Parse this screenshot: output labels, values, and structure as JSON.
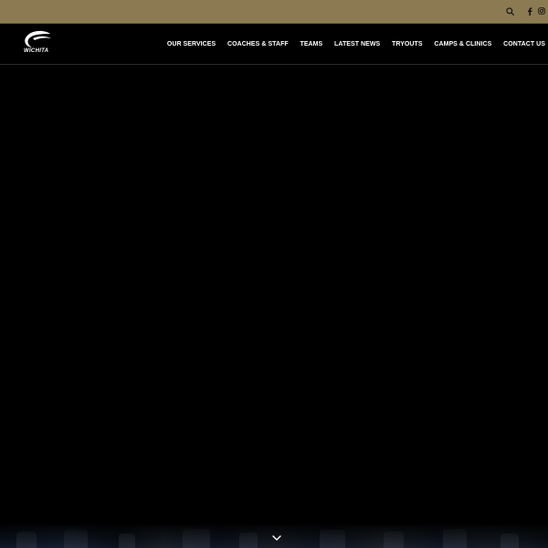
{
  "topbar": {
    "icons": [
      "search-icon",
      "facebook-icon",
      "instagram-icon"
    ],
    "background_color": "#8b7a52"
  },
  "header": {
    "logo_text": "WICHITA",
    "nav": [
      {
        "label": "OUR SERVICES"
      },
      {
        "label": "COACHES & STAFF"
      },
      {
        "label": "TEAMS"
      },
      {
        "label": "LATEST NEWS"
      },
      {
        "label": "TRYOUTS"
      },
      {
        "label": "CAMPS & CLINICS"
      },
      {
        "label": "CONTACT US"
      }
    ]
  },
  "hero": {
    "background_color": "#000000"
  },
  "scroll_indicator": {
    "icon": "chevron-down-icon"
  }
}
